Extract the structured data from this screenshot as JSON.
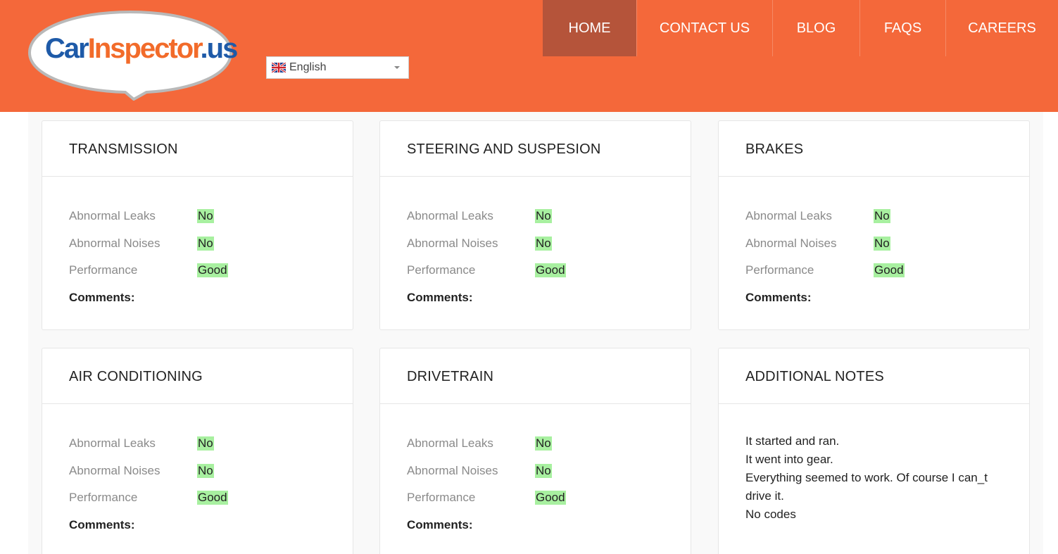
{
  "header": {
    "logo": {
      "text_car": "Car",
      "text_inspector": "Inspector",
      "text_us": ".us"
    },
    "language": {
      "label": "English",
      "flag_icon": "uk-flag-icon"
    },
    "nav": [
      "HOME",
      "CONTACT US",
      "BLOG",
      "FAQS",
      "CAREERS"
    ],
    "colors": {
      "header_bg": "#f4683a",
      "active_nav_bg": "#b5543a",
      "value_highlight": "#a8f0a0"
    }
  },
  "panels": [
    {
      "title": "TRANSMISSION",
      "rows": [
        {
          "label": "Abnormal Leaks",
          "value": "No"
        },
        {
          "label": "Abnormal Noises",
          "value": "No"
        },
        {
          "label": "Performance",
          "value": "Good"
        }
      ],
      "comments_label": "Comments:"
    },
    {
      "title": "STEERING AND SUSPESION",
      "rows": [
        {
          "label": "Abnormal Leaks",
          "value": "No"
        },
        {
          "label": "Abnormal Noises",
          "value": "No"
        },
        {
          "label": "Performance",
          "value": "Good"
        }
      ],
      "comments_label": "Comments:"
    },
    {
      "title": "BRAKES",
      "rows": [
        {
          "label": "Abnormal Leaks",
          "value": "No"
        },
        {
          "label": "Abnormal Noises",
          "value": "No"
        },
        {
          "label": "Performance",
          "value": "Good"
        }
      ],
      "comments_label": "Comments:"
    },
    {
      "title": "AIR CONDITIONING",
      "rows": [
        {
          "label": "Abnormal Leaks",
          "value": "No"
        },
        {
          "label": "Abnormal Noises",
          "value": "No"
        },
        {
          "label": "Performance",
          "value": "Good"
        }
      ],
      "comments_label": "Comments:"
    },
    {
      "title": "DRIVETRAIN",
      "rows": [
        {
          "label": "Abnormal Leaks",
          "value": "No"
        },
        {
          "label": "Abnormal Noises",
          "value": "No"
        },
        {
          "label": "Performance",
          "value": "Good"
        }
      ],
      "comments_label": "Comments:"
    }
  ],
  "notes": {
    "title": "ADDITIONAL NOTES",
    "lines": [
      "It started and ran.",
      "It went into gear.",
      "Everything seemed to work. Of course I can_t",
      "drive it.",
      "No codes"
    ]
  }
}
